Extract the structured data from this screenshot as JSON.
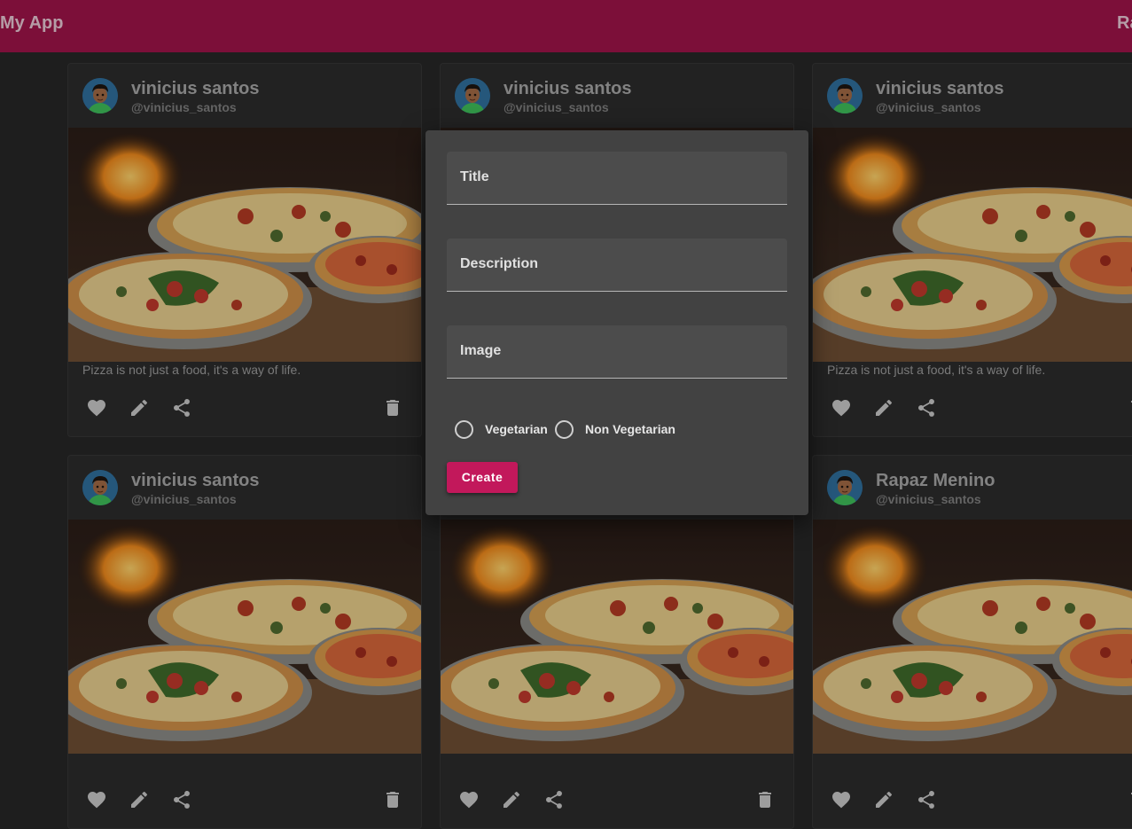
{
  "appbar": {
    "title": "My App",
    "right_text": "Rapaz"
  },
  "cards": [
    {
      "name": "vinicius santos",
      "handle": "@vinicius_santos",
      "caption": "Pizza is not just a food, it's a way of life."
    },
    {
      "name": "vinicius santos",
      "handle": "@vinicius_santos",
      "caption": ""
    },
    {
      "name": "vinicius santos",
      "handle": "@vinicius_santos",
      "caption": "Pizza is not just a food, it's a way of life."
    },
    {
      "name": "vinicius santos",
      "handle": "@vinicius_santos",
      "caption": ""
    },
    {
      "name": "vinicius santos",
      "handle": "@vinicius_santos",
      "caption": ""
    },
    {
      "name": "Rapaz Menino",
      "handle": "@vinicius_santos",
      "caption": ""
    }
  ],
  "dialog": {
    "fields": [
      {
        "label": "Title",
        "value": ""
      },
      {
        "label": "Description",
        "value": ""
      },
      {
        "label": "Image",
        "value": ""
      }
    ],
    "radio_options": [
      "Vegetarian",
      "Non Vegetarian"
    ],
    "create_label": "Create"
  },
  "icons": {
    "like": "heart-icon",
    "edit": "pencil-icon",
    "share": "share-icon",
    "delete": "trash-icon"
  },
  "colors": {
    "appbar": "#87103e",
    "accent": "#c2185b",
    "background": "#1e1e1e",
    "card": "#2b2b2b",
    "dialog": "#424242"
  }
}
